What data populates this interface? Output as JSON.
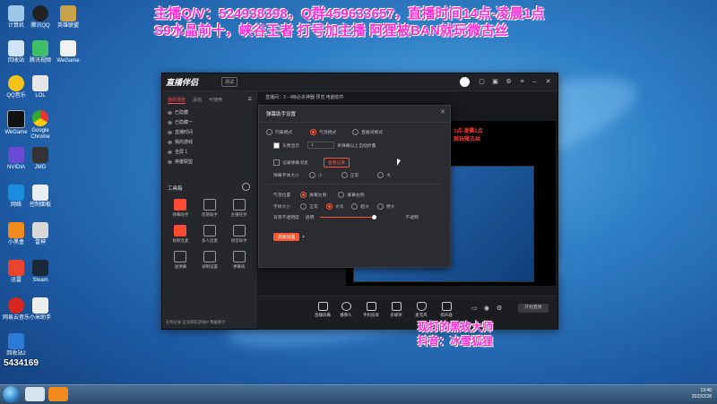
{
  "overlay": {
    "line1": "主播Q/V：524938398，Q群459633657，直播时间14点-凌晨1点",
    "line2": "S9水晶前十，峡谷王者      打号加主播           阿狸被BAN就玩微古丝",
    "bottom1": "现打的黑玫大师",
    "bottom2": "抖音：冰雪狐狸"
  },
  "desktop_icons": [
    {
      "label": "计算机"
    },
    {
      "label": "腾讯QQ"
    },
    {
      "label": "英雄联盟"
    },
    {
      "label": "回收站"
    },
    {
      "label": "腾讯视频"
    },
    {
      "label": "WeGame"
    },
    {
      "label": "QQ音乐"
    },
    {
      "label": "LOL"
    },
    {
      "label": "WeGame"
    },
    {
      "label": "Google Chrome"
    },
    {
      "label": "NVIDIA"
    },
    {
      "label": "JMG"
    },
    {
      "label": "网络"
    },
    {
      "label": "控制面板"
    },
    {
      "label": "小黑盒"
    },
    {
      "label": "雷神"
    },
    {
      "label": "迅雷"
    },
    {
      "label": "Steam"
    },
    {
      "label": "网易云音乐"
    },
    {
      "label": "小米助手"
    },
    {
      "label": "回收站2"
    }
  ],
  "app": {
    "logo": "直播伴侣",
    "version_badge": "测试",
    "left_tabs": [
      "我的场景",
      "添加",
      "可使用"
    ],
    "scenes": [
      "已隐藏",
      "已隐藏一",
      "直播时间",
      "我的游戏",
      "全屏 1",
      "英雄联盟"
    ],
    "tools_title": "工具箱",
    "tools": [
      {
        "label": "弹幕助手"
      },
      {
        "label": "房管助手"
      },
      {
        "label": "主播任务"
      },
      {
        "label": "视频连麦"
      },
      {
        "label": "多人连麦"
      },
      {
        "label": "语音助手"
      },
      {
        "label": "送弹幕"
      },
      {
        "label": "录制设置"
      },
      {
        "label": "弹幕商"
      },
      {
        "label": "礼物"
      },
      {
        "label": "动态"
      },
      {
        "label": "下载"
      }
    ],
    "left_footer": "礼物记录   自动获取游戏IP   数据统计",
    "scene_bar": "直播间：3 - 4级必杀神器   预览              电脑软件",
    "bottom_bar": [
      "直播屏幕",
      "摄像头",
      "手机投屏",
      "多媒体",
      "麦克风",
      "扬声器"
    ],
    "start_live": "开始直播"
  },
  "dialog": {
    "title": "弹幕助手设置",
    "modes": [
      "列表模式",
      "气泡模式",
      "直播间模式"
    ],
    "show_avatar": "头像显示",
    "lines_value": "1",
    "lines_suffix": "条弹幕以上自动折叠",
    "record_label": "记录弹幕消息",
    "record_btn": "查看记录",
    "font_label": "弹幕字体大小",
    "font_options": [
      "小",
      "正常",
      "大"
    ],
    "bubble_pos": "气泡位置",
    "bubble_pos_options": [
      "屏幕左侧",
      "屏幕右侧"
    ],
    "font_size": "字体大小",
    "font_size_options": [
      "正常",
      "大号",
      "超大",
      "特大"
    ],
    "bg_opacity": "背景不透明度",
    "opacity_left": "透明",
    "opacity_right": "不透明",
    "advanced_btn": "高级设置"
  },
  "taskbar": {
    "time": "13:46",
    "date": "2022/2/28"
  },
  "watermark": "5434169"
}
